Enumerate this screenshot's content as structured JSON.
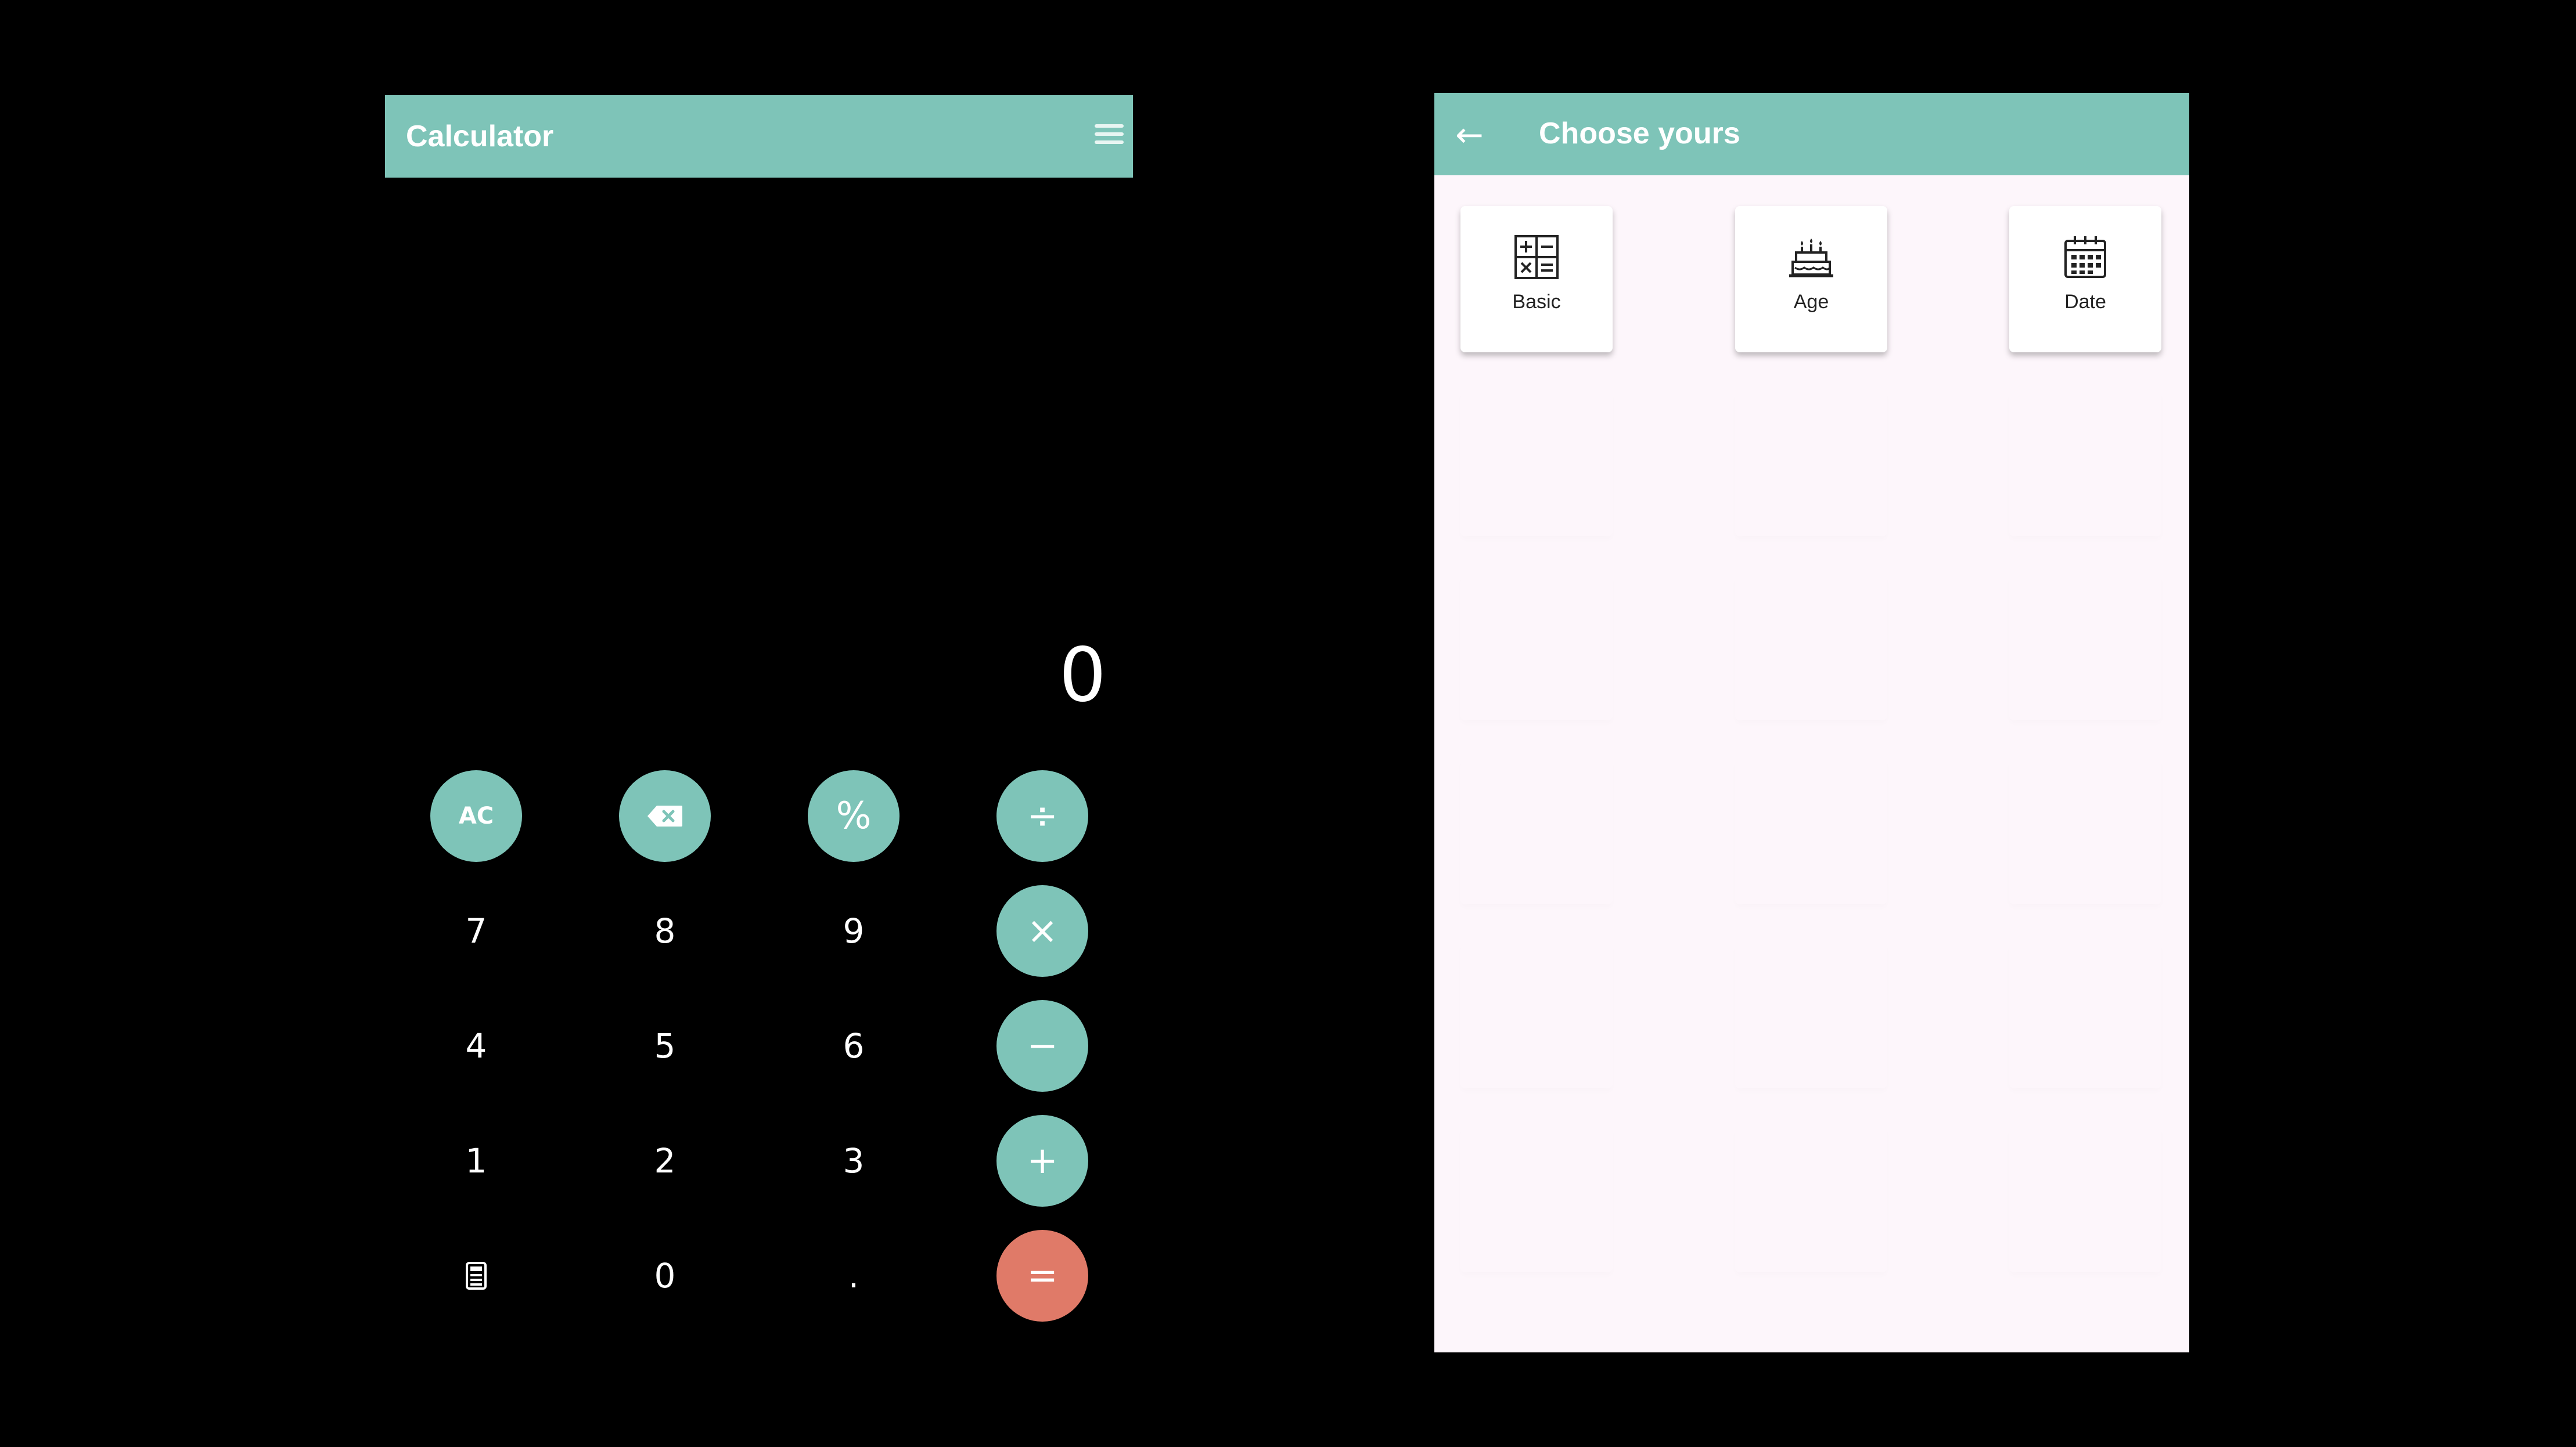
{
  "calculator": {
    "title": "Calculator",
    "display": "0",
    "keys": {
      "ac": "AC",
      "backspace": "⌫",
      "percent": "%",
      "divide": "÷",
      "seven": "7",
      "eight": "8",
      "nine": "9",
      "multiply": "×",
      "four": "4",
      "five": "5",
      "six": "6",
      "minus": "−",
      "one": "1",
      "two": "2",
      "three": "3",
      "plus": "+",
      "zero": "0",
      "dot": ".",
      "equals": "="
    },
    "icons": [
      "menu-icon",
      "backspace-icon",
      "calculator-icon"
    ],
    "colors": {
      "accent": "#7ec4b8",
      "equals": "#e07a68",
      "background": "#000000"
    }
  },
  "chooser": {
    "title": "Choose yours",
    "cards": [
      {
        "label": "Basic",
        "icon": "basic-calc-icon"
      },
      {
        "label": "Age",
        "icon": "cake-icon"
      },
      {
        "label": "Date",
        "icon": "calendar-icon"
      }
    ],
    "colors": {
      "accent": "#7ec4b8",
      "background": "#fdf6fb"
    }
  }
}
